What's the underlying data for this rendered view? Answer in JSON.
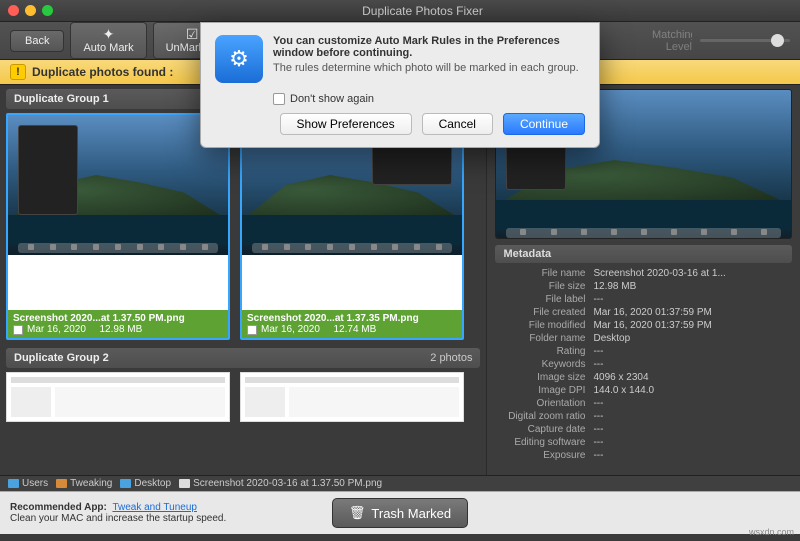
{
  "app_title": "Duplicate Photos Fixer",
  "toolbar": {
    "back": "Back",
    "automark": "Auto Mark",
    "unmarkall": "UnMark All",
    "matching_level": "Matching Level"
  },
  "warn": {
    "text_prefix": "Duplicate photos found : "
  },
  "groups": [
    {
      "title": "Duplicate Group 1",
      "cards": [
        {
          "filename": "Screenshot 2020...at 1.37.50 PM.png",
          "date": "Mar 16, 2020",
          "size": "12.98 MB"
        },
        {
          "filename": "Screenshot 2020...at 1.37.35 PM.png",
          "date": "Mar 16, 2020",
          "size": "12.74 MB"
        }
      ]
    },
    {
      "title": "Duplicate Group 2",
      "count_label": "2 photos"
    }
  ],
  "metadata": {
    "header": "Metadata",
    "rows": [
      {
        "k": "File name",
        "v": "Screenshot 2020-03-16 at 1..."
      },
      {
        "k": "File size",
        "v": "12.98 MB"
      },
      {
        "k": "File label",
        "v": "---"
      },
      {
        "k": "File created",
        "v": "Mar 16, 2020 01:37:59 PM"
      },
      {
        "k": "File modified",
        "v": "Mar 16, 2020 01:37:59 PM"
      },
      {
        "k": "Folder name",
        "v": "Desktop"
      },
      {
        "k": "Rating",
        "v": "---"
      },
      {
        "k": "Keywords",
        "v": "---"
      },
      {
        "k": "Image size",
        "v": "4096 x 2304"
      },
      {
        "k": "Image DPI",
        "v": "144.0 x 144.0"
      },
      {
        "k": "Orientation",
        "v": "---"
      },
      {
        "k": "Digital zoom ratio",
        "v": "---"
      },
      {
        "k": "Capture date",
        "v": "---"
      },
      {
        "k": "Editing software",
        "v": "---"
      },
      {
        "k": "Exposure",
        "v": "---"
      }
    ]
  },
  "path": [
    "Users",
    "Tweaking",
    "Desktop"
  ],
  "path_file": "Screenshot 2020-03-16 at 1.37.50 PM.png",
  "promo": {
    "label": "Recommended App:",
    "link": "Tweak and Tuneup",
    "desc": "Clean your MAC and increase the startup speed."
  },
  "trash_label": "Trash Marked",
  "dialog": {
    "title": "You can customize Auto Mark Rules in the Preferences window before continuing.",
    "sub": "The rules determine which photo will be marked in each group.",
    "dontshow": "Don't show again",
    "show_prefs": "Show Preferences",
    "cancel": "Cancel",
    "continue": "Continue"
  },
  "watermark": "wsxdn.com"
}
